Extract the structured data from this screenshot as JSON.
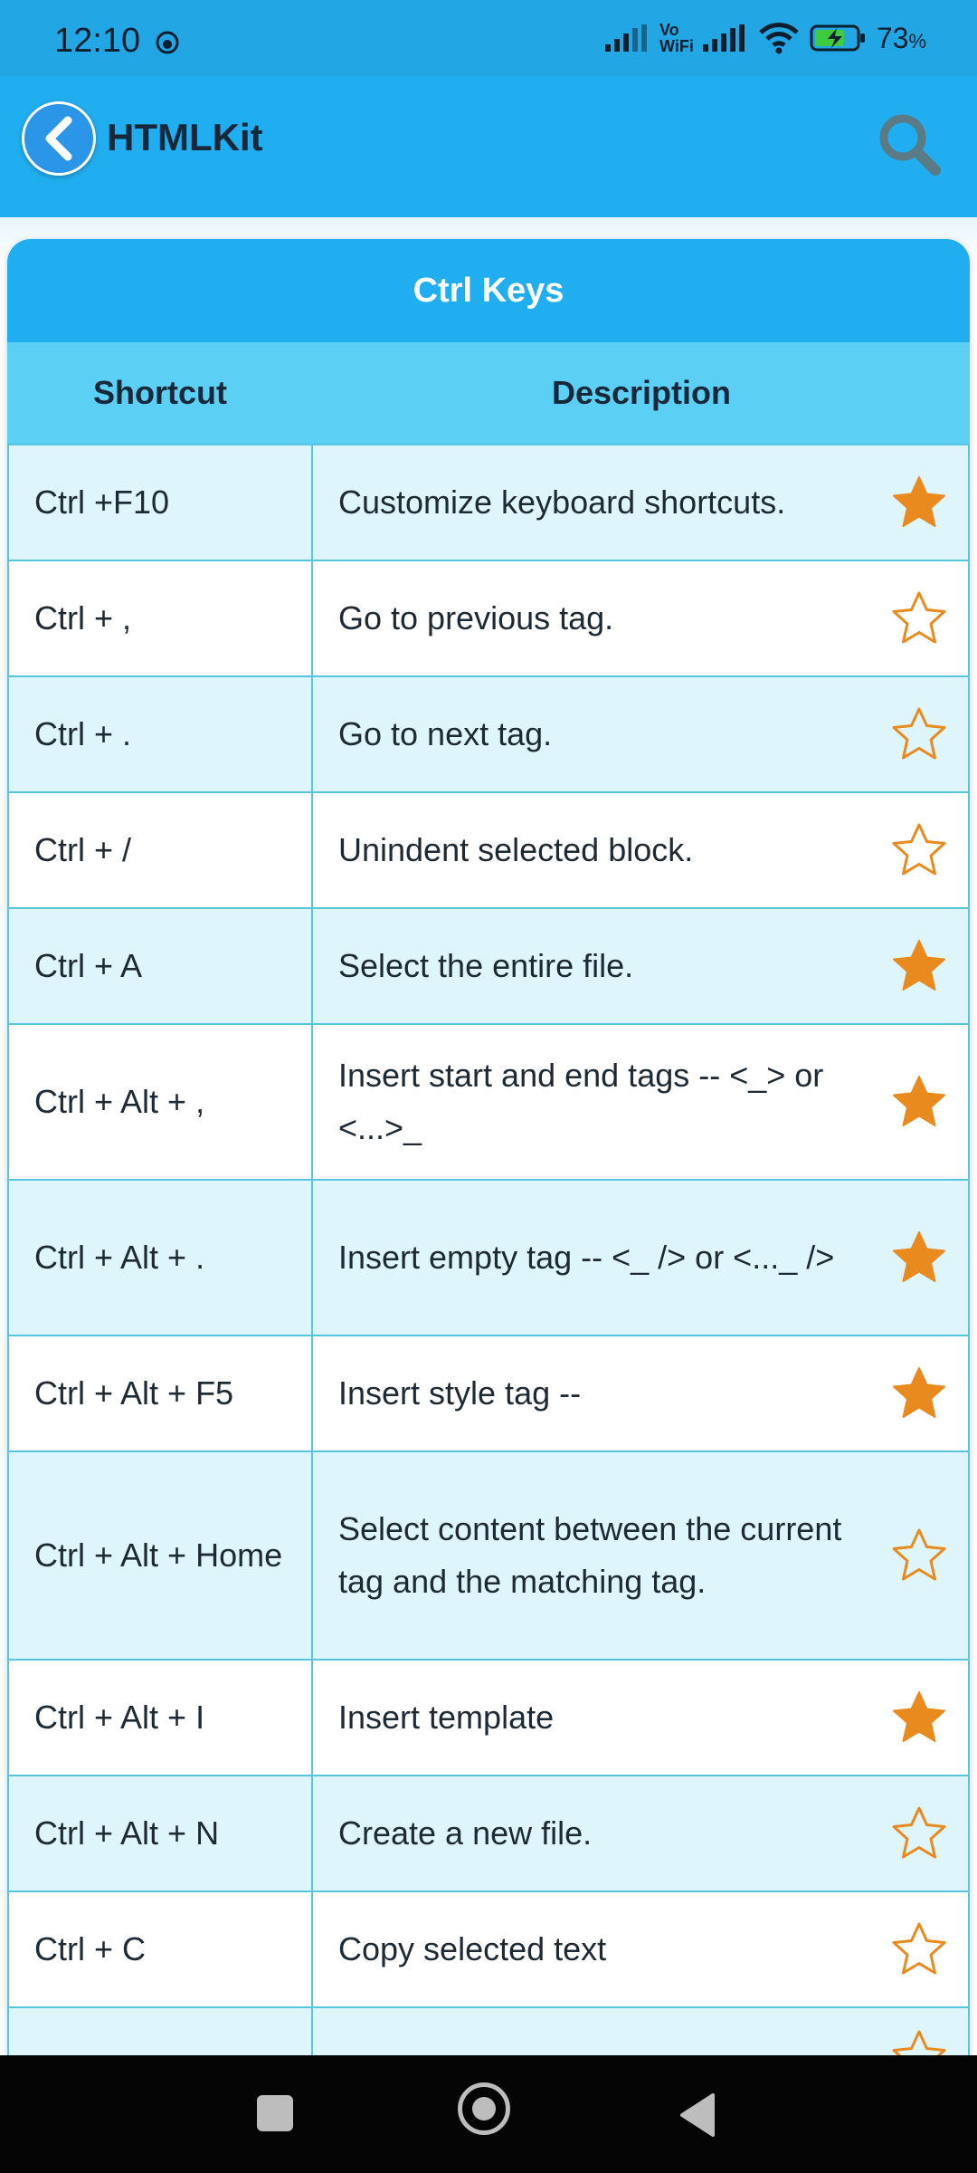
{
  "status_bar": {
    "time": "12:10",
    "battery_percent": "73",
    "network_label_top": "Vo",
    "network_label_bottom": "WiFi"
  },
  "app_bar": {
    "title": "HTMLKit"
  },
  "table": {
    "title": "Ctrl Keys",
    "headers": {
      "shortcut": "Shortcut",
      "description": "Description"
    },
    "rows": [
      {
        "shortcut": "Ctrl +F10",
        "description": "Customize keyboard shortcuts.",
        "favorite": true
      },
      {
        "shortcut": "Ctrl + ,",
        "description": "Go to previous tag.",
        "favorite": false
      },
      {
        "shortcut": "Ctrl + .",
        "description": "Go to next tag.",
        "favorite": false
      },
      {
        "shortcut": "Ctrl + /",
        "description": "Unindent selected block.",
        "favorite": false
      },
      {
        "shortcut": "Ctrl + A",
        "description": "Select the entire file.",
        "favorite": true
      },
      {
        "shortcut": "Ctrl + Alt + ,",
        "description": "Insert start and end tags -- <_> or <...>_",
        "favorite": true
      },
      {
        "shortcut": "Ctrl + Alt + .",
        "description": "Insert empty tag -- <_ /> or <..._ />",
        "favorite": true
      },
      {
        "shortcut": "Ctrl + Alt + F5",
        "description": "Insert style tag --",
        "favorite": true
      },
      {
        "shortcut": "Ctrl + Alt + Home",
        "description": "Select content between the current tag and the matching tag.",
        "favorite": false
      },
      {
        "shortcut": "Ctrl + Alt + I",
        "description": "Insert template",
        "favorite": true
      },
      {
        "shortcut": "Ctrl + Alt + N",
        "description": "Create a new file.",
        "favorite": false
      },
      {
        "shortcut": "Ctrl + C",
        "description": "Copy selected text",
        "favorite": false
      },
      {
        "shortcut": "",
        "description": "",
        "favorite": false
      }
    ]
  },
  "icons": {
    "back": "chevron-left-icon",
    "search": "search-icon",
    "star_filled": "star-filled-icon",
    "star_outline": "star-outline-icon"
  },
  "colors": {
    "app_bar": "#21aef0",
    "header_row": "#5bd0f4",
    "odd_row": "#ddf5fb",
    "star": "#e98a1f"
  }
}
